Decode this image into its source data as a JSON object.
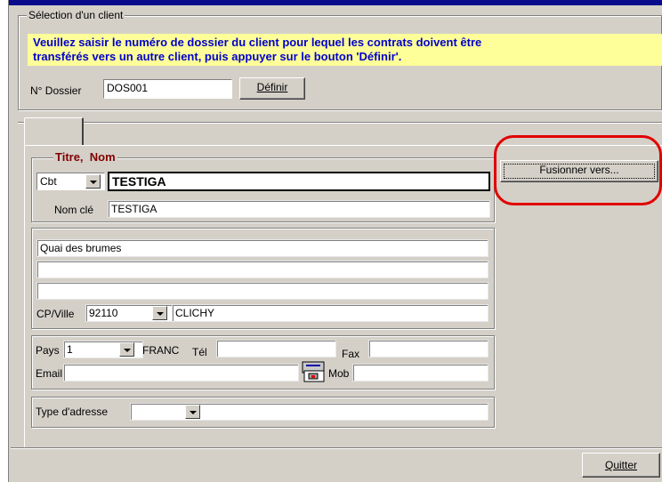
{
  "selection_group": {
    "legend": "Sélection d'un client",
    "info_line1": "Veuillez saisir le numéro de dossier du client pour lequel les contrats doivent être",
    "info_line2": "transférés vers un autre client, puis appuyer sur le bouton 'Définir'.",
    "dossier_label": "N° Dossier",
    "dossier_value": "DOS001",
    "define_button_label": "Définir"
  },
  "client": {
    "title_label": "Titre,",
    "name_label": "Nom",
    "title_value": "Cbt",
    "name_value": "TESTIGA",
    "key_name_label": "Nom clé",
    "key_name_value": "TESTIGA"
  },
  "merge_button_label": "Fusionner vers...",
  "address": {
    "line1": "Quai des brumes",
    "line2": "",
    "line3": "",
    "cp_city_label": "CP/Ville",
    "postal_code": "92110",
    "city": "CLICHY"
  },
  "contact": {
    "country_label": "Pays",
    "country_code": "1",
    "country_name": "FRANC",
    "phone_label": "Tél",
    "phone_value": "",
    "fax_label": "Fax",
    "fax_value": "",
    "email_label": "Email",
    "email_value": "",
    "mobile_label": "Mob",
    "mobile_value": ""
  },
  "address_type": {
    "label": "Type d'adresse",
    "value": ""
  },
  "quit_button_label": "Quitter",
  "colors": {
    "info_background": "#ffff99",
    "info_text": "#0000cc",
    "title_name_label": "#800000",
    "highlight_ring": "#e00000",
    "window_background": "#d4d0c8"
  }
}
